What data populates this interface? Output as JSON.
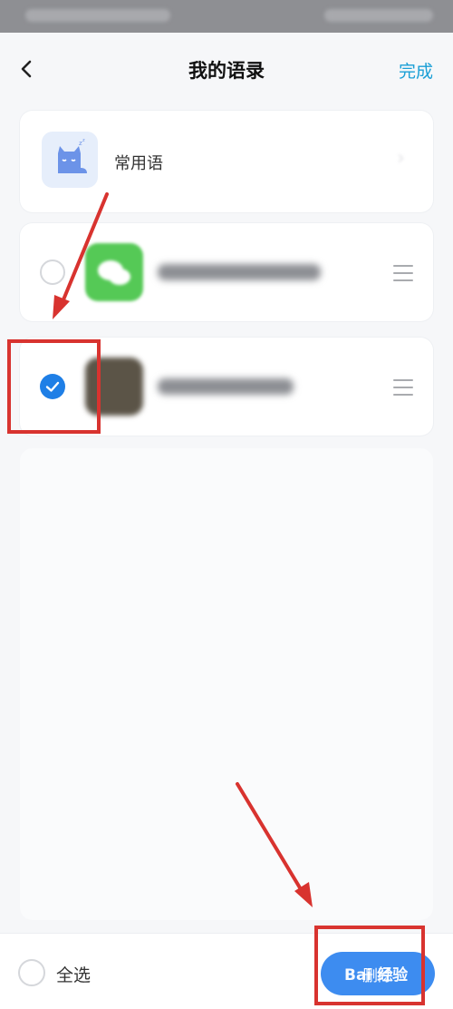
{
  "header": {
    "title": "我的语录",
    "done_label": "完成"
  },
  "group": {
    "label": "常用语",
    "icon": "sleeping-cat-icon"
  },
  "items": [
    {
      "icon": "wechat-icon",
      "selected": false
    },
    {
      "icon": "photo-thumbnail-icon",
      "selected": true
    }
  ],
  "bottom": {
    "select_all_label": "全选",
    "delete_label": "删除"
  },
  "watermark": {
    "text": "Bai 经验"
  },
  "colors": {
    "accent": "#1a9fd6",
    "selected_radio": "#1f7fe6",
    "delete_button": "#3d8cf0",
    "annotation_red": "#d8332f"
  }
}
